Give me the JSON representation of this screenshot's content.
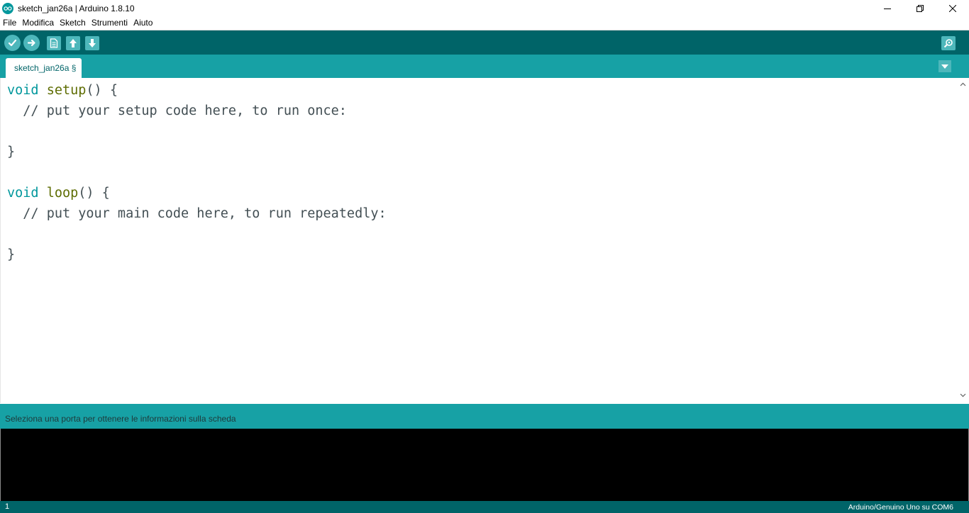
{
  "window": {
    "title": "sketch_jan26a | Arduino 1.8.10",
    "icon": "arduino-logo-icon"
  },
  "menu": {
    "items": [
      "File",
      "Modifica",
      "Sketch",
      "Strumenti",
      "Aiuto"
    ]
  },
  "toolbar": {
    "buttons": [
      "verify-icon",
      "upload-icon",
      "new-icon",
      "open-icon",
      "save-icon"
    ],
    "right_button": "serial-monitor-icon"
  },
  "tabs": {
    "active_label": "sketch_jan26a §"
  },
  "editor": {
    "lines": [
      {
        "type": "void",
        "fn": "setup",
        "rest": "() {"
      },
      {
        "comment": "  // put your setup code here, to run once:"
      },
      {
        "text": ""
      },
      {
        "text": "}"
      },
      {
        "text": ""
      },
      {
        "type": "void",
        "fn": "loop",
        "rest": "() {"
      },
      {
        "comment": "  // put your main code here, to run repeatedly:"
      },
      {
        "text": ""
      },
      {
        "text": "}"
      }
    ]
  },
  "status": {
    "message": "Seleziona una porta per ottenere le informazioni sulla scheda"
  },
  "footer": {
    "line_number": "1",
    "board": "Arduino/Genuino Uno su COM6"
  },
  "colors": {
    "teal_dark": "#006468",
    "teal": "#17a1a5",
    "button": "#4db7bb",
    "keyword_type": "#00979c",
    "keyword_function": "#5e6d03"
  }
}
